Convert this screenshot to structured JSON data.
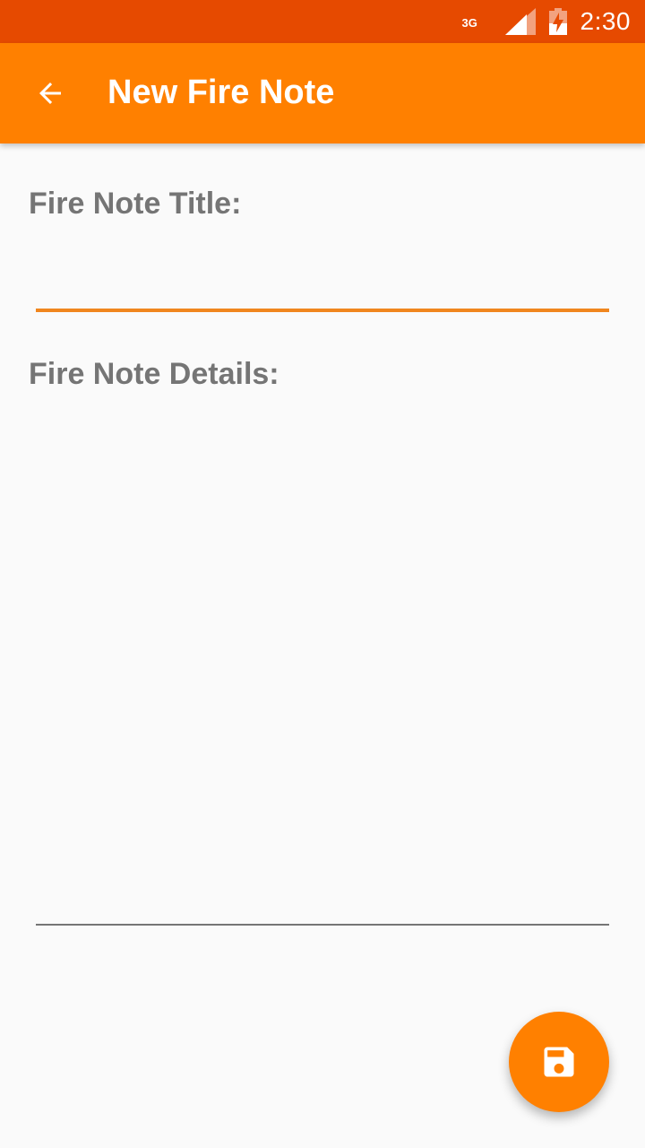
{
  "status_bar": {
    "network": "3G",
    "time": "2:30",
    "icons": [
      "signal-icon",
      "battery-charging-icon"
    ]
  },
  "app_bar": {
    "title": "New Fire Note",
    "back_icon": "arrow-back-icon"
  },
  "form": {
    "title_label": "Fire Note Title:",
    "title_value": "",
    "details_label": "Fire Note Details:",
    "details_value": ""
  },
  "fab": {
    "icon": "save-icon"
  },
  "colors": {
    "status_bar": "#e64a00",
    "app_bar": "#ff8000",
    "accent": "#f0861e",
    "label": "#757575",
    "background": "#fafafa"
  }
}
